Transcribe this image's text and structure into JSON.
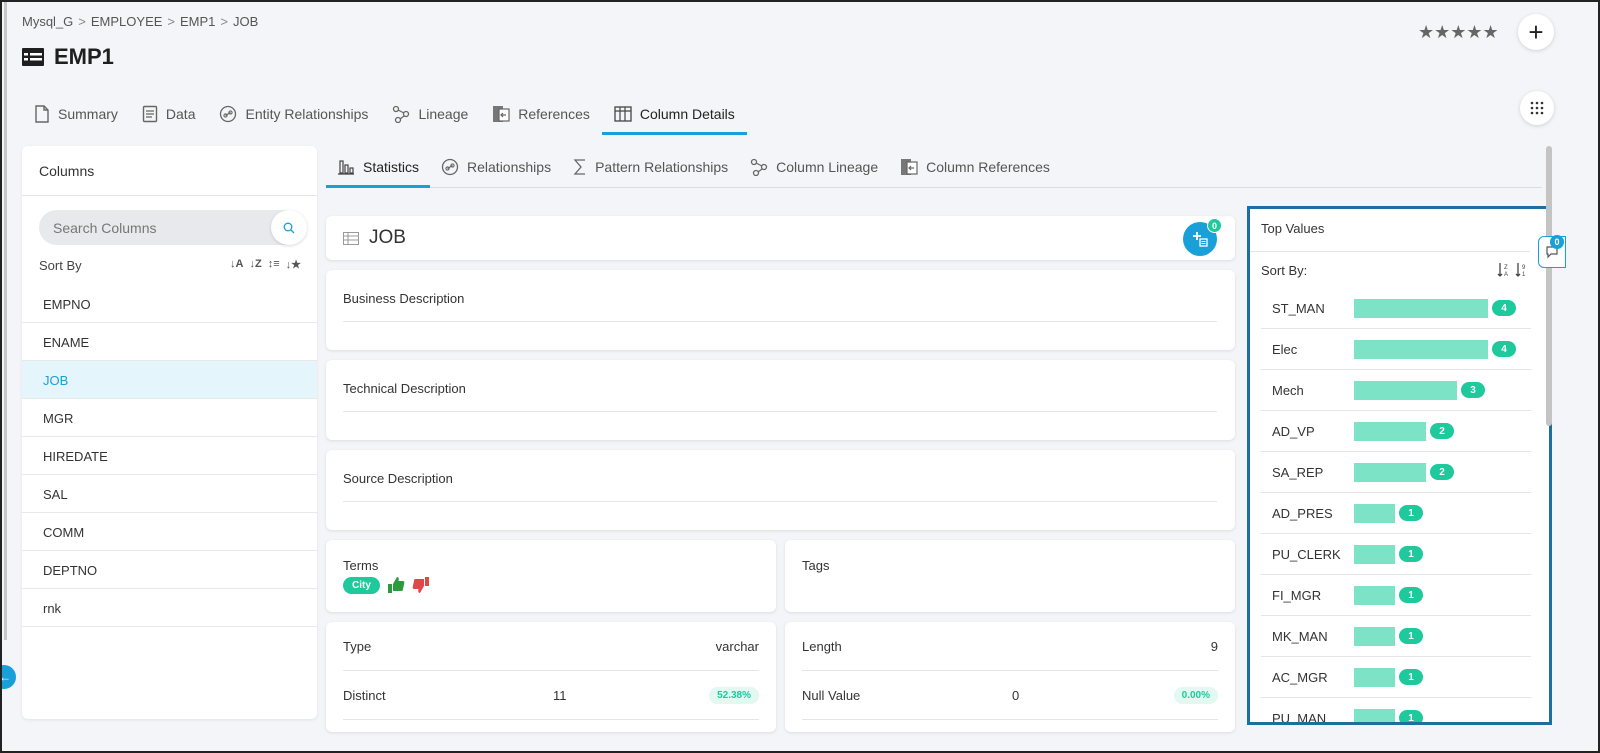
{
  "breadcrumb": [
    "Mysql_G",
    "EMPLOYEE",
    "EMP1",
    "JOB"
  ],
  "breadcrumb_separator": ">",
  "page_title": "EMP1",
  "rating": {
    "stars": "★★★★★",
    "value": 0,
    "max": 5
  },
  "plus_label": "+",
  "main_tabs": [
    {
      "label": "Summary",
      "icon": "document-icon"
    },
    {
      "label": "Data",
      "icon": "data-icon"
    },
    {
      "label": "Entity Relationships",
      "icon": "link-icon"
    },
    {
      "label": "Lineage",
      "icon": "lineage-icon"
    },
    {
      "label": "References",
      "icon": "references-icon"
    },
    {
      "label": "Column Details",
      "icon": "table-icon",
      "active": true
    }
  ],
  "columns_panel": {
    "title": "Columns",
    "search_placeholder": "Search Columns",
    "sort_label": "Sort By",
    "items": [
      "EMPNO",
      "ENAME",
      "JOB",
      "MGR",
      "HIREDATE",
      "SAL",
      "COMM",
      "DEPTNO",
      "rnk"
    ],
    "selected": "JOB"
  },
  "sub_tabs": [
    {
      "label": "Statistics",
      "icon": "bar-chart-icon",
      "active": true
    },
    {
      "label": "Relationships",
      "icon": "link-icon"
    },
    {
      "label": "Pattern Relationships",
      "icon": "sigma-icon"
    },
    {
      "label": "Column Lineage",
      "icon": "lineage-icon"
    },
    {
      "label": "Column References",
      "icon": "references-icon"
    }
  ],
  "column_detail": {
    "title": "JOB",
    "add_badge": "0",
    "business_description_label": "Business Description",
    "technical_description_label": "Technical Description",
    "source_description_label": "Source Description",
    "terms_label": "Terms",
    "term_chip": "City",
    "tags_label": "Tags",
    "type_label": "Type",
    "type_value": "varchar",
    "length_label": "Length",
    "length_value": "9",
    "distinct_label": "Distinct",
    "distinct_value": "11",
    "distinct_pct": "52.38%",
    "null_label": "Null Value",
    "null_value": "0",
    "null_pct": "0.00%"
  },
  "top_values": {
    "title": "Top Values",
    "sort_label": "Sort By:",
    "max_count": 4,
    "items": [
      {
        "name": "ST_MAN",
        "count": 4
      },
      {
        "name": "Elec",
        "count": 4
      },
      {
        "name": "Mech",
        "count": 3
      },
      {
        "name": "AD_VP",
        "count": 2
      },
      {
        "name": "SA_REP",
        "count": 2
      },
      {
        "name": "AD_PRES",
        "count": 1
      },
      {
        "name": "PU_CLERK",
        "count": 1
      },
      {
        "name": "FI_MGR",
        "count": 1
      },
      {
        "name": "MK_MAN",
        "count": 1
      },
      {
        "name": "AC_MGR",
        "count": 1
      },
      {
        "name": "PU_MAN",
        "count": 1
      }
    ]
  },
  "side_badge": "0",
  "colors": {
    "accent": "#1aa0d8",
    "green": "#1ec99b",
    "bar": "#7de3c7",
    "highlight_border": "#1d6fa0"
  }
}
